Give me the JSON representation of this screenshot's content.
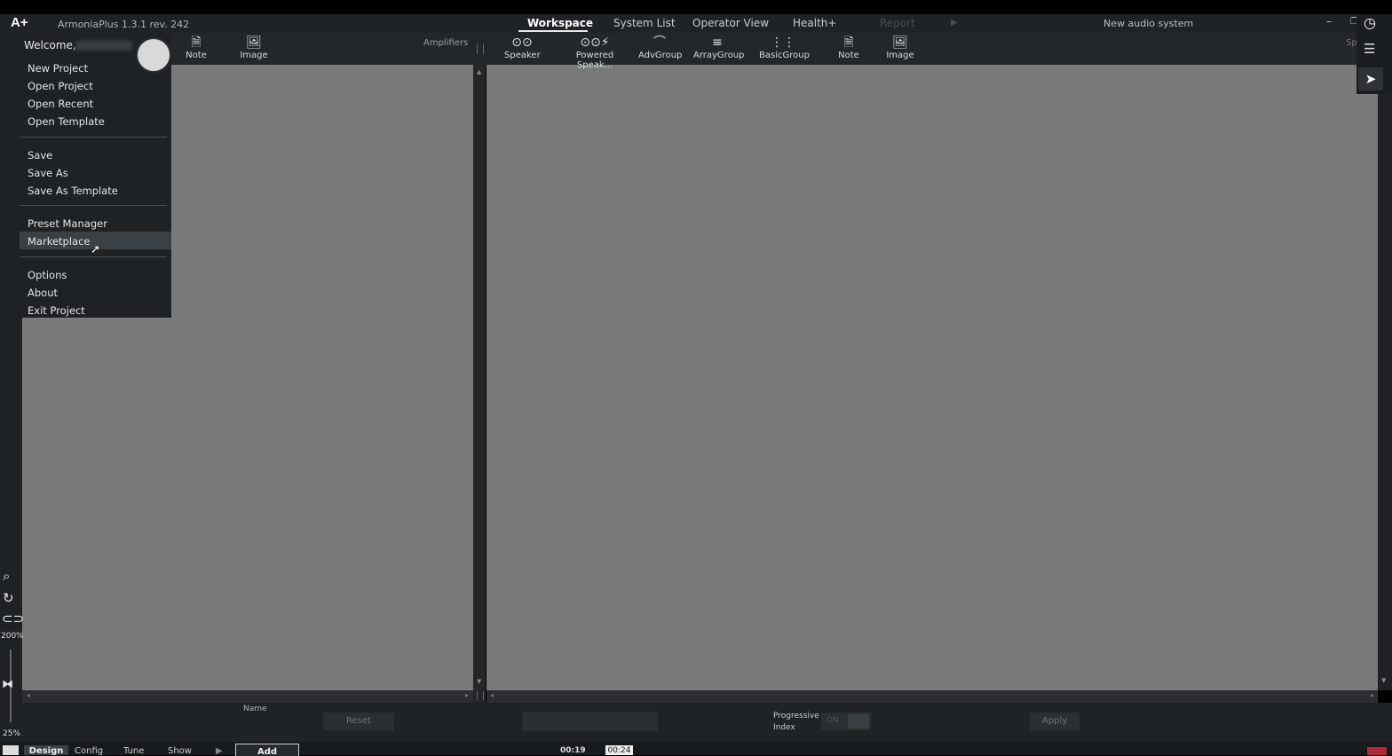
{
  "app": {
    "logo": "A+",
    "version": "ArmoniaPlus 1.3.1  rev. 242",
    "system_name": "New audio system"
  },
  "tabs": [
    {
      "label": "Workspace"
    },
    {
      "label": "System List"
    },
    {
      "label": "Operator View"
    },
    {
      "label": "Health+"
    },
    {
      "label": "Report"
    }
  ],
  "left_toolbar": {
    "note": "Note",
    "image": "Image",
    "amplifiers": "Amplifiers"
  },
  "right_toolbar": {
    "speaker": "Speaker",
    "powered": "Powered Speak...",
    "advgroup": "AdvGroup",
    "arraygroup": "ArrayGroup",
    "basicgroup": "BasicGroup",
    "note": "Note",
    "image": "Image",
    "sp": "Sp"
  },
  "menu": {
    "welcome": "Welcome,",
    "items": [
      "New Project",
      "Open Project",
      "Open Recent",
      "Open Template",
      "Save",
      "Save As",
      "Save As Template",
      "Preset Manager",
      "Marketplace",
      "Options",
      "About",
      "Exit Project"
    ]
  },
  "zoom": {
    "level_top": "200%",
    "level_bottom": "25%"
  },
  "bottom": {
    "name_label": "Name",
    "reset": "Reset",
    "progressive": "Progressive",
    "index": "Index",
    "toggle": "ON",
    "apply": "Apply"
  },
  "status": {
    "design": "Design",
    "config": "Config",
    "tune": "Tune",
    "show": "Show",
    "add": "Add",
    "time1": "00:19",
    "time2": "00:24"
  }
}
